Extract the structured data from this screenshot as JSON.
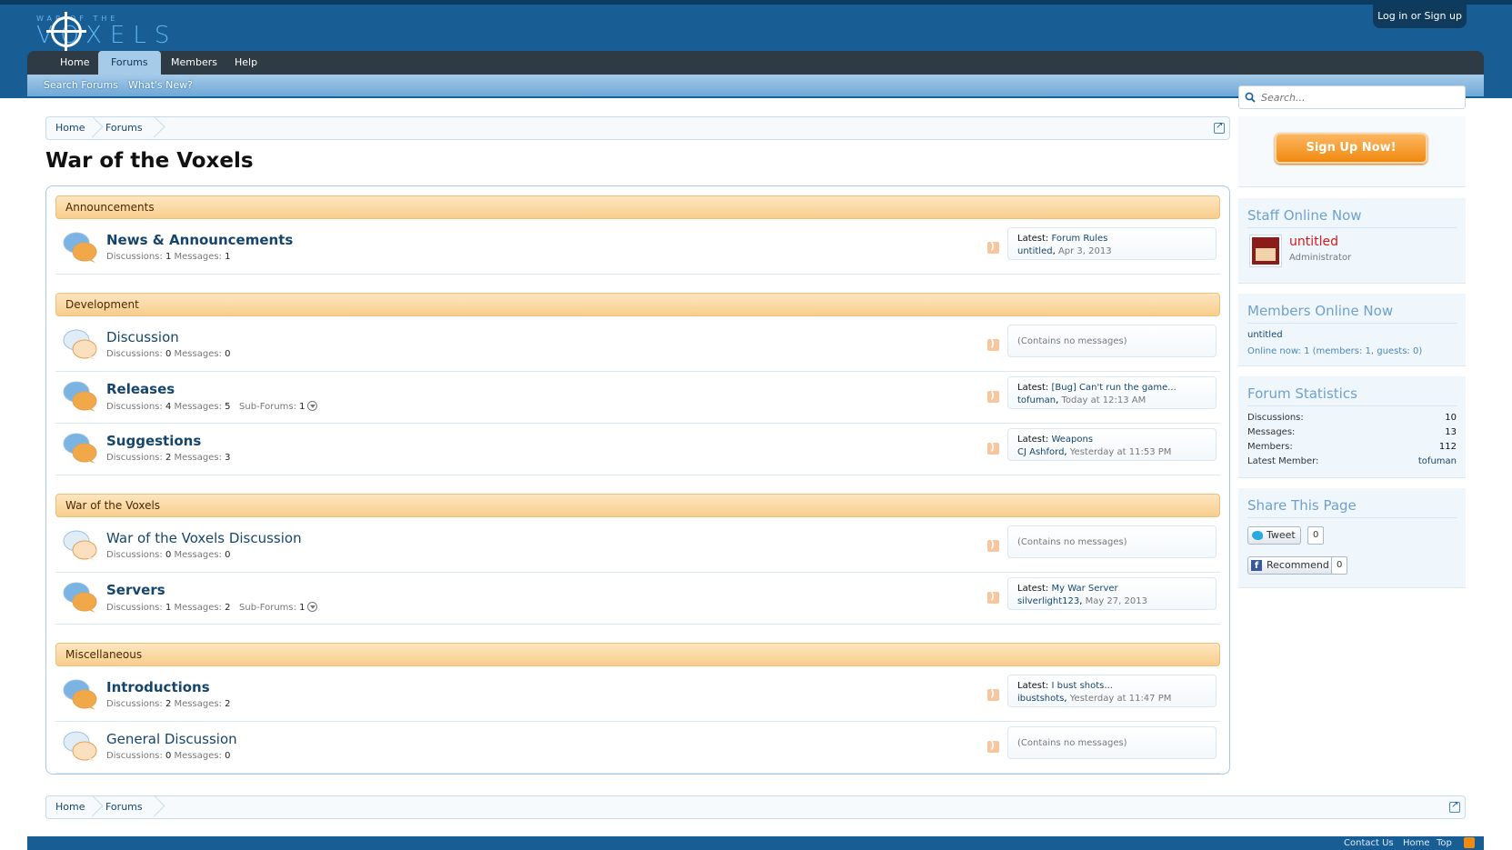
{
  "header": {
    "logo_small": "WAR OF THE",
    "logo_big": "VOXELS",
    "login_label": "Log in or Sign up"
  },
  "nav": {
    "tabs": [
      {
        "label": "Home"
      },
      {
        "label": "Forums"
      },
      {
        "label": "Members"
      },
      {
        "label": "Help"
      }
    ],
    "selected": "Forums",
    "subnav": [
      {
        "label": "Search Forums"
      },
      {
        "label": "What's New?"
      }
    ]
  },
  "search": {
    "placeholder": "Search..."
  },
  "breadcrumb": {
    "items": [
      {
        "label": "Home"
      },
      {
        "label": "Forums"
      }
    ]
  },
  "page": {
    "title": "War of the Voxels"
  },
  "labels": {
    "discussions": "Discussions:",
    "messages": "Messages:",
    "sub_forums": "Sub-Forums:",
    "latest": "Latest:",
    "no_messages": "(Contains no messages)"
  },
  "categories": [
    {
      "name": "Announcements",
      "forums": [
        {
          "title": "News & Announcements",
          "unread": true,
          "discussions": "1",
          "messages": "1",
          "subforums": null,
          "latest_thread": "Forum Rules",
          "latest_user": "untitled",
          "latest_date": "Apr 3, 2013"
        }
      ]
    },
    {
      "name": "Development",
      "forums": [
        {
          "title": "Discussion",
          "unread": false,
          "discussions": "0",
          "messages": "0",
          "subforums": null,
          "latest_thread": null
        },
        {
          "title": "Releases",
          "unread": true,
          "discussions": "4",
          "messages": "5",
          "subforums": "1",
          "latest_thread": "[Bug] Can't run the game...",
          "latest_user": "tofuman",
          "latest_date": "Today at 12:13 AM"
        },
        {
          "title": "Suggestions",
          "unread": true,
          "discussions": "2",
          "messages": "3",
          "subforums": null,
          "latest_thread": "Weapons",
          "latest_user": "CJ Ashford",
          "latest_date": "Yesterday at 11:53 PM"
        }
      ]
    },
    {
      "name": "War of the Voxels",
      "forums": [
        {
          "title": "War of the Voxels Discussion",
          "unread": false,
          "discussions": "0",
          "messages": "0",
          "subforums": null,
          "latest_thread": null
        },
        {
          "title": "Servers",
          "unread": true,
          "discussions": "1",
          "messages": "2",
          "subforums": "1",
          "latest_thread": "My War Server",
          "latest_user": "silverlight123",
          "latest_date": "May 27, 2013"
        }
      ]
    },
    {
      "name": "Miscellaneous",
      "forums": [
        {
          "title": "Introductions",
          "unread": true,
          "discussions": "2",
          "messages": "2",
          "subforums": null,
          "latest_thread": "I bust shots...",
          "latest_user": "ibustshots",
          "latest_date": "Yesterday at 11:47 PM"
        },
        {
          "title": "General Discussion",
          "unread": false,
          "discussions": "0",
          "messages": "0",
          "subforums": null,
          "latest_thread": null
        }
      ]
    }
  ],
  "sidebar": {
    "signup_label": "Sign Up Now!",
    "staff": {
      "title": "Staff Online Now",
      "name": "untitled",
      "role": "Administrator"
    },
    "members_online": {
      "title": "Members Online Now",
      "member": "untitled",
      "summary": "Online now: 1 (members: 1, guests: 0)"
    },
    "stats": {
      "title": "Forum Statistics",
      "rows": [
        {
          "label": "Discussions:",
          "value": "10"
        },
        {
          "label": "Messages:",
          "value": "13"
        },
        {
          "label": "Members:",
          "value": "112"
        },
        {
          "label": "Latest Member:",
          "value": "tofuman"
        }
      ]
    },
    "share": {
      "title": "Share This Page",
      "tweet_label": "Tweet",
      "tweet_count": "0",
      "recommend_label": "Recommend",
      "recommend_count": "0"
    }
  },
  "footer": {
    "links": [
      {
        "label": "Contact Us"
      },
      {
        "label": "Home"
      },
      {
        "label": "Top"
      }
    ]
  },
  "colors": {
    "brand": "#185d94",
    "category": "#f8cd8c",
    "link": "#16456c",
    "staff": "#d11a1a",
    "signup": "#f08a10"
  }
}
